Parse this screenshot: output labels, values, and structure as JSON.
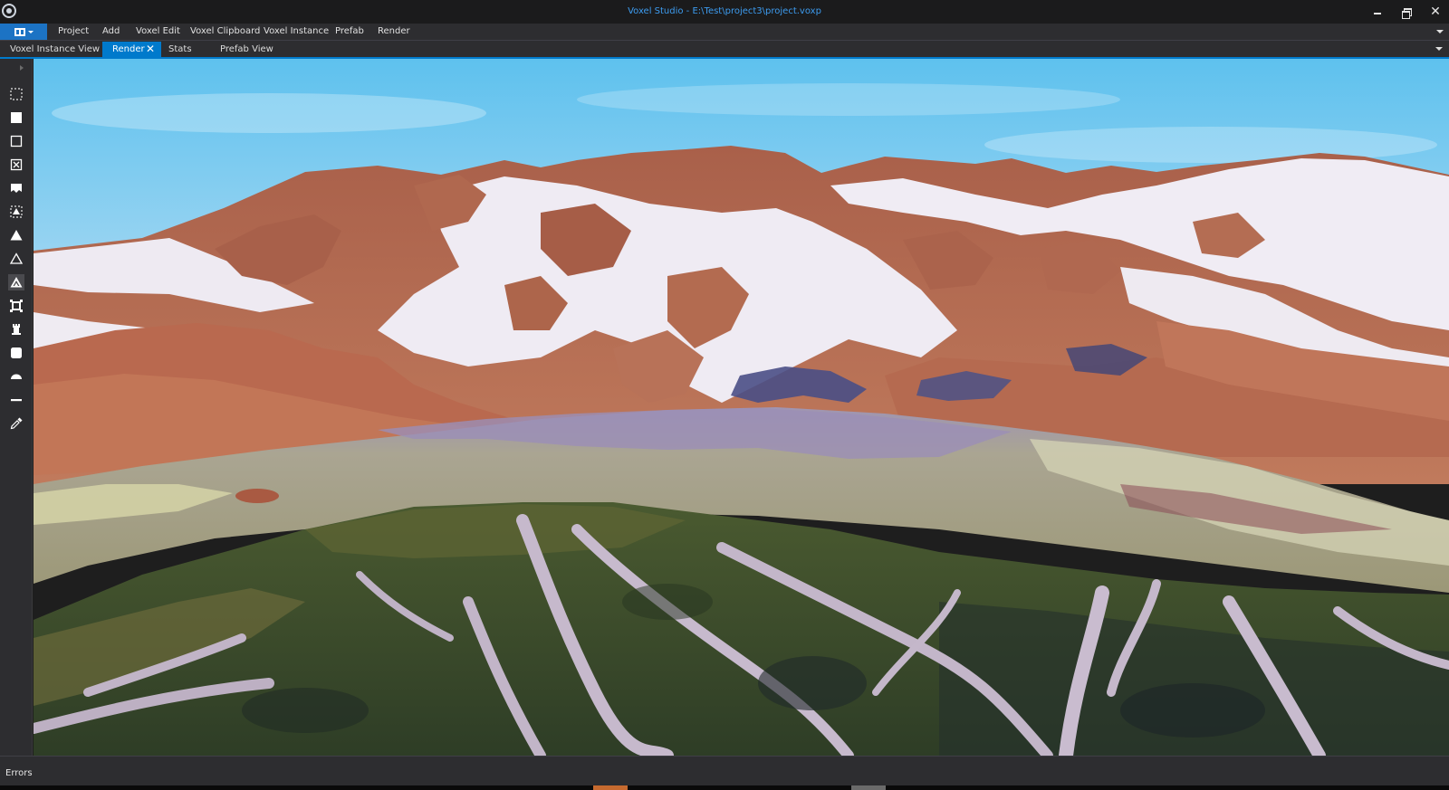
{
  "window": {
    "title": "Voxel Studio - E:\\Test\\project3\\project.voxp",
    "minimize_icon": "minimize-icon",
    "maximize_icon": "restore-icon",
    "close_glyph": "✕"
  },
  "menu": {
    "app_button_icon": "layout-icon",
    "items": [
      "Project",
      "Add",
      "Voxel Edit",
      "Voxel Clipboard",
      "Voxel Instance",
      "Prefab",
      "Render"
    ]
  },
  "tabs": {
    "items": [
      {
        "label": "Voxel Instance View",
        "active": false
      },
      {
        "label": "Render",
        "active": true
      },
      {
        "label": "Stats",
        "active": false
      },
      {
        "label": "Prefab View",
        "active": false
      }
    ],
    "close_glyph": "✕"
  },
  "toolbar": {
    "tools": [
      "select-rectangle-icon",
      "solid-box-icon",
      "outline-box-icon",
      "delete-box-icon",
      "stamp-icon",
      "select-region-icon",
      "solid-triangle-icon",
      "outline-triangle-icon",
      "layered-triangle-icon",
      "transform-box-icon",
      "tower-icon",
      "rounded-box-icon",
      "dome-icon",
      "flatten-icon",
      "eyedropper-icon"
    ]
  },
  "viewport": {
    "scene": "rendered-voxel-terrain",
    "colors": {
      "sky_top": "#5ec1ee",
      "sky_bottom": "#c9e6f4",
      "snow": "#efeaf4",
      "rock": "#b56a4f",
      "water": "#a29e86",
      "forest": "#3c4f2c"
    }
  },
  "status": {
    "errors_label": "Errors"
  }
}
